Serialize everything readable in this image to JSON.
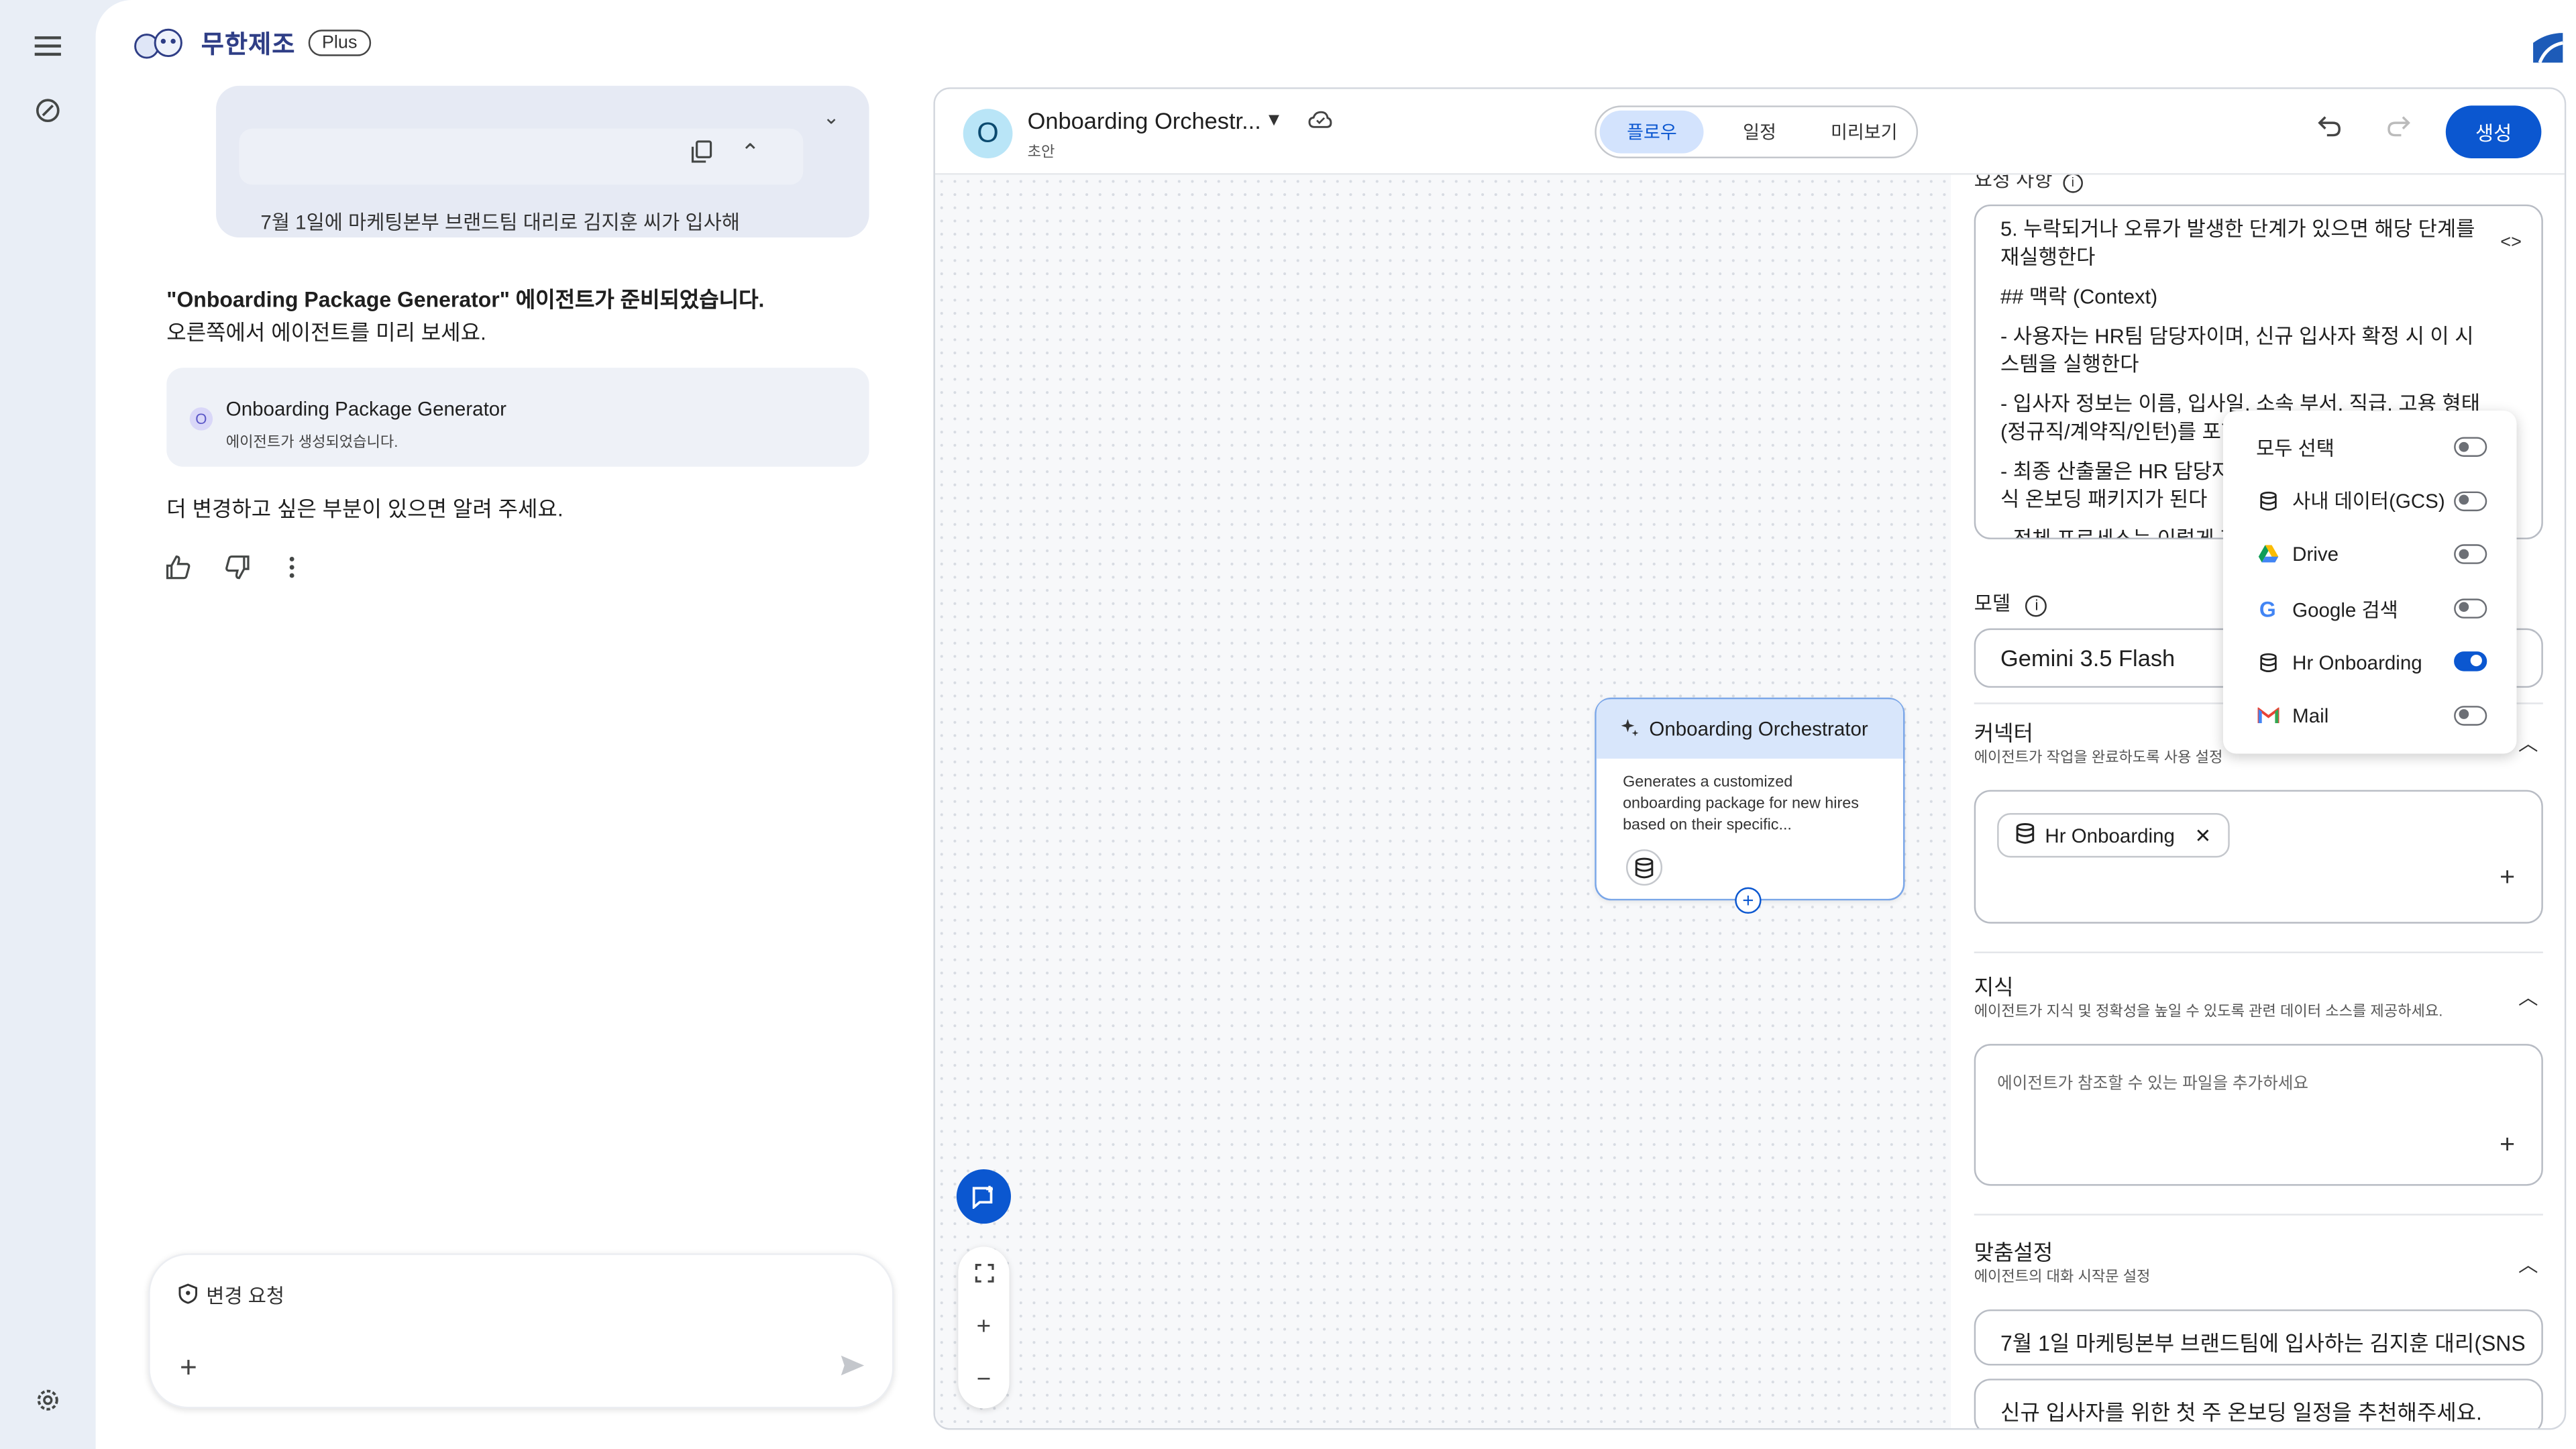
{
  "brand": {
    "name": "무한제조",
    "plan": "Plus"
  },
  "chat": {
    "collapsed_preview": "7월 1일에 마케팅본부 브랜드팀 대리로 김지훈 씨가 입사해",
    "ready_title": "\"Onboarding Package Generator\" 에이전트가 준비되었습니다.",
    "ready_sub": "오른쪽에서 에이전트를 미리 보세요.",
    "agent_card": {
      "initial": "O",
      "name": "Onboarding Package Generator",
      "status": "에이전트가 생성되었습니다."
    },
    "followup": "더 변경하고 싶은 부분이 있으면 알려 주세요.",
    "composer": {
      "chip_label": "변경 요청"
    }
  },
  "editor": {
    "agent_initial": "O",
    "agent_name": "Onboarding Orchestr...",
    "agent_status": "초안",
    "tabs": [
      {
        "label": "플로우",
        "active": true
      },
      {
        "label": "일정",
        "active": false
      },
      {
        "label": "미리보기",
        "active": false
      }
    ],
    "create_label": "생성",
    "node": {
      "title": "Onboarding Orchestrator",
      "description": "Generates a customized onboarding package for new hires based on their specific..."
    }
  },
  "config": {
    "instructions_label": "요청 사항",
    "instructions": [
      "5. 누락되거나 오류가 발생한 단계가 있으면 해당 단계를 재실행한다",
      "## 맥락 (Context)",
      "- 사용자는 HR팀 담당자이며, 신규 입사자 확정 시 이 시스템을 실행한다",
      "- 입사자 정보는 이름, 입사일, 소속 부서, 직급, 고용 형태(정규직/계약직/인턴)를 포함",
      "- 최종 산출물은 HR 담당자가 검토 후 신규 입사자에게 공식 온보딩 패키지가 된다",
      "- 전체 프로세스는 이렇게 진행"
    ],
    "model_label": "모델",
    "model_value": "Gemini 3.5 Flash",
    "connectors": {
      "title": "커넥터",
      "subtitle": "에이전트가 작업을 완료하도록 사용 설정",
      "chip": "Hr Onboarding"
    },
    "knowledge": {
      "title": "지식",
      "subtitle": "에이전트가 지식 및 정확성을 높일 수 있도록 관련 데이터 소스를 제공하세요.",
      "placeholder": "에이전트가 참조할 수 있는 파일을 추가하세요"
    },
    "customize": {
      "title": "맞춤설정",
      "subtitle": "에이전트의 대화 시작문 설정",
      "starters": [
        "7월 1일 마케팅본부 브랜드팀에 입사하는 김지훈 대리(SNS",
        "신규 입사자를 위한 첫 주 온보딩 일정을 추천해주세요."
      ]
    }
  },
  "connector_menu": [
    {
      "label": "모두 선택",
      "icon": "",
      "on": false
    },
    {
      "label": "사내 데이터(GCS)",
      "icon": "database-icon",
      "on": false
    },
    {
      "label": "Drive",
      "icon": "drive-icon",
      "on": false
    },
    {
      "label": "Google 검색",
      "icon": "google-icon",
      "on": false
    },
    {
      "label": "Hr Onboarding",
      "icon": "database-icon",
      "on": true
    },
    {
      "label": "Mail",
      "icon": "gmail-icon",
      "on": false
    }
  ],
  "colors": {
    "accent": "#0b57d0",
    "node_header": "#d8e6fb",
    "agent_avatar": "#b9e5f7"
  }
}
